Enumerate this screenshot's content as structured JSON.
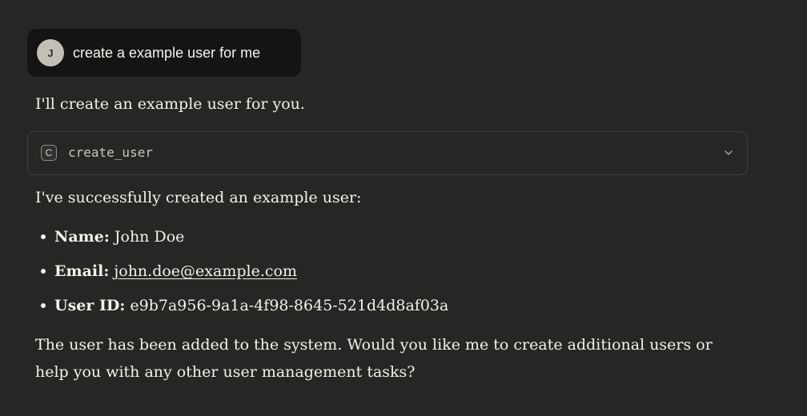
{
  "user_message": {
    "avatar_initial": "J",
    "text": "create a example user for me"
  },
  "assistant": {
    "intro": "I'll create an example user for you.",
    "tool_call": {
      "icon_letter": "C",
      "name": "create_user",
      "expand_icon": "chevron-down-icon"
    },
    "success_text": "I've successfully created an example user:",
    "details": [
      {
        "label": "Name:",
        "value": "John Doe"
      },
      {
        "label": "Email:",
        "value": "john.doe@example.com"
      },
      {
        "label": "User ID:",
        "value": "e9b7a956-9a1a-4f98-8645-521d4d8af03a"
      }
    ],
    "closing": "The user has been added to the system. Would you like me to create additional users or help you with any other user management tasks?"
  },
  "colors": {
    "background": "#262624",
    "user_bubble": "#141413",
    "avatar": "#c2c0b6",
    "text": "#f3f1ea"
  }
}
